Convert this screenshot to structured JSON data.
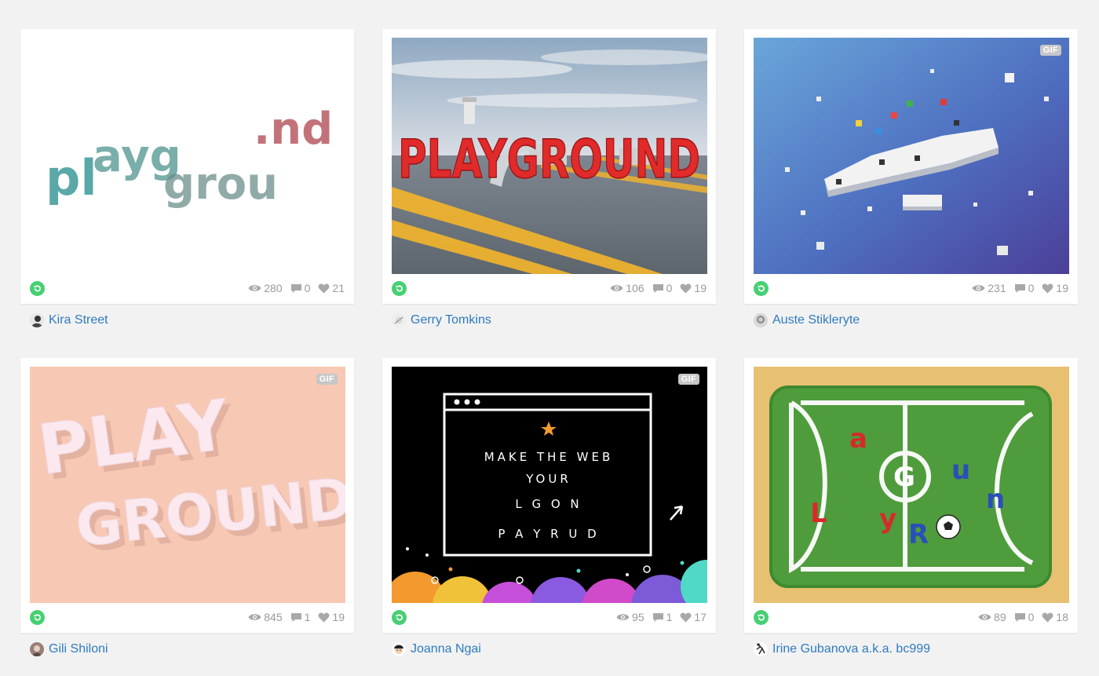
{
  "cards": [
    {
      "author": "Kira Street",
      "views": "280",
      "comments": "0",
      "likes": "21",
      "gif": false
    },
    {
      "author": "Gerry Tomkins",
      "views": "106",
      "comments": "0",
      "likes": "19",
      "gif": false
    },
    {
      "author": "Auste Stiklerytе",
      "views": "231",
      "comments": "0",
      "likes": "19",
      "gif": true
    },
    {
      "author": "Gili Shiloni",
      "views": "845",
      "comments": "1",
      "likes": "19",
      "gif": true
    },
    {
      "author": "Joanna Ngai",
      "views": "95",
      "comments": "1",
      "likes": "17",
      "gif": true
    },
    {
      "author": "Irine Gubanova a.k.a. bc999",
      "views": "89",
      "comments": "0",
      "likes": "18",
      "gif": false
    }
  ],
  "labels": {
    "gif_badge": "GIF"
  },
  "art": {
    "kira_text_1": "pl",
    "kira_text_2": "ayg",
    "kira_text_3": "grou",
    "kira_text_4": ".nd",
    "gerry_text": "PLAYGROUND",
    "gili_line_1": "PLAY",
    "gili_line_2": "GROUND",
    "joanna_line_1": "MAKE THE WEB",
    "joanna_line_2": "YOUR",
    "joanna_line_3": "L  G  O  N",
    "joanna_line_4": "P  A  Y  R  U  D"
  },
  "colors": {
    "link": "#2e7bbf",
    "remix": "#47cf73",
    "stats": "#9a9a9a",
    "card": "#ffffff",
    "page": "#f2f2f2"
  }
}
